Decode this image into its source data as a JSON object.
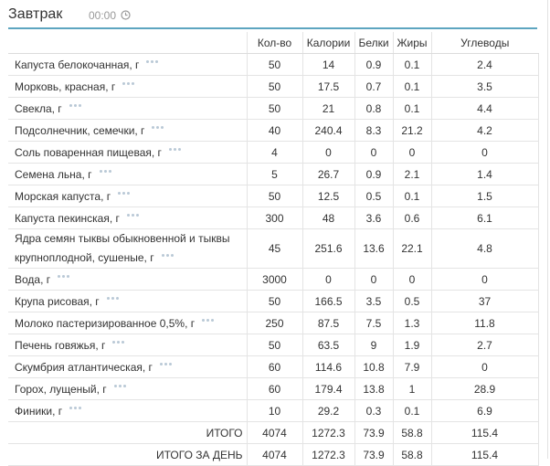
{
  "meal": {
    "title": "Завтрак",
    "time": "00:00"
  },
  "columns": [
    "Кол-во",
    "Калории",
    "Белки",
    "Жиры",
    "Углеводы"
  ],
  "rows": [
    {
      "name": "Капуста белокочанная, г",
      "qty": "50",
      "kcal": "14",
      "protein": "0.9",
      "fat": "0.1",
      "carbs": "2.4"
    },
    {
      "name": "Морковь, красная, г",
      "qty": "50",
      "kcal": "17.5",
      "protein": "0.7",
      "fat": "0.1",
      "carbs": "3.5"
    },
    {
      "name": "Свекла, г",
      "qty": "50",
      "kcal": "21",
      "protein": "0.8",
      "fat": "0.1",
      "carbs": "4.4"
    },
    {
      "name": "Подсолнечник, семечки, г",
      "qty": "40",
      "kcal": "240.4",
      "protein": "8.3",
      "fat": "21.2",
      "carbs": "4.2"
    },
    {
      "name": "Соль поваренная пищевая, г",
      "qty": "4",
      "kcal": "0",
      "protein": "0",
      "fat": "0",
      "carbs": "0"
    },
    {
      "name": "Семена льна, г",
      "qty": "5",
      "kcal": "26.7",
      "protein": "0.9",
      "fat": "2.1",
      "carbs": "1.4"
    },
    {
      "name": "Морская капуста, г",
      "qty": "50",
      "kcal": "12.5",
      "protein": "0.5",
      "fat": "0.1",
      "carbs": "1.5"
    },
    {
      "name": "Капуста пекинская, г",
      "qty": "300",
      "kcal": "48",
      "protein": "3.6",
      "fat": "0.6",
      "carbs": "6.1"
    },
    {
      "name_line1": "Ядра семян тыквы обыкновенной и тыквы",
      "name_line2": "крупноплодной, сушеные, г",
      "qty": "45",
      "kcal": "251.6",
      "protein": "13.6",
      "fat": "22.1",
      "carbs": "4.8"
    },
    {
      "name": "Вода, г",
      "qty": "3000",
      "kcal": "0",
      "protein": "0",
      "fat": "0",
      "carbs": "0"
    },
    {
      "name": "Крупа рисовая, г",
      "qty": "50",
      "kcal": "166.5",
      "protein": "3.5",
      "fat": "0.5",
      "carbs": "37"
    },
    {
      "name": "Молоко пастеризированное 0,5%, г",
      "qty": "250",
      "kcal": "87.5",
      "protein": "7.5",
      "fat": "1.3",
      "carbs": "11.8"
    },
    {
      "name": "Печень говяжья, г",
      "qty": "50",
      "kcal": "63.5",
      "protein": "9",
      "fat": "1.9",
      "carbs": "2.7"
    },
    {
      "name": "Скумбрия атлантическая, г",
      "qty": "60",
      "kcal": "114.6",
      "protein": "10.8",
      "fat": "7.9",
      "carbs": "0"
    },
    {
      "name": "Горох, лущеный, г",
      "qty": "60",
      "kcal": "179.4",
      "protein": "13.8",
      "fat": "1",
      "carbs": "28.9"
    },
    {
      "name": "Финики, г",
      "qty": "10",
      "kcal": "29.2",
      "protein": "0.3",
      "fat": "0.1",
      "carbs": "6.9"
    }
  ],
  "totals": [
    {
      "label": "ИТОГО",
      "qty": "4074",
      "kcal": "1272.3",
      "protein": "73.9",
      "fat": "58.8",
      "carbs": "115.4"
    },
    {
      "label": "ИТОГО ЗА ДЕНЬ",
      "qty": "4074",
      "kcal": "1272.3",
      "protein": "73.9",
      "fat": "58.8",
      "carbs": "115.4"
    }
  ],
  "icons": {
    "clock": "clock-icon",
    "more": "more-dots-icon"
  },
  "colors": {
    "accent": "#5da5c0",
    "dots": "#b9c9d6"
  }
}
